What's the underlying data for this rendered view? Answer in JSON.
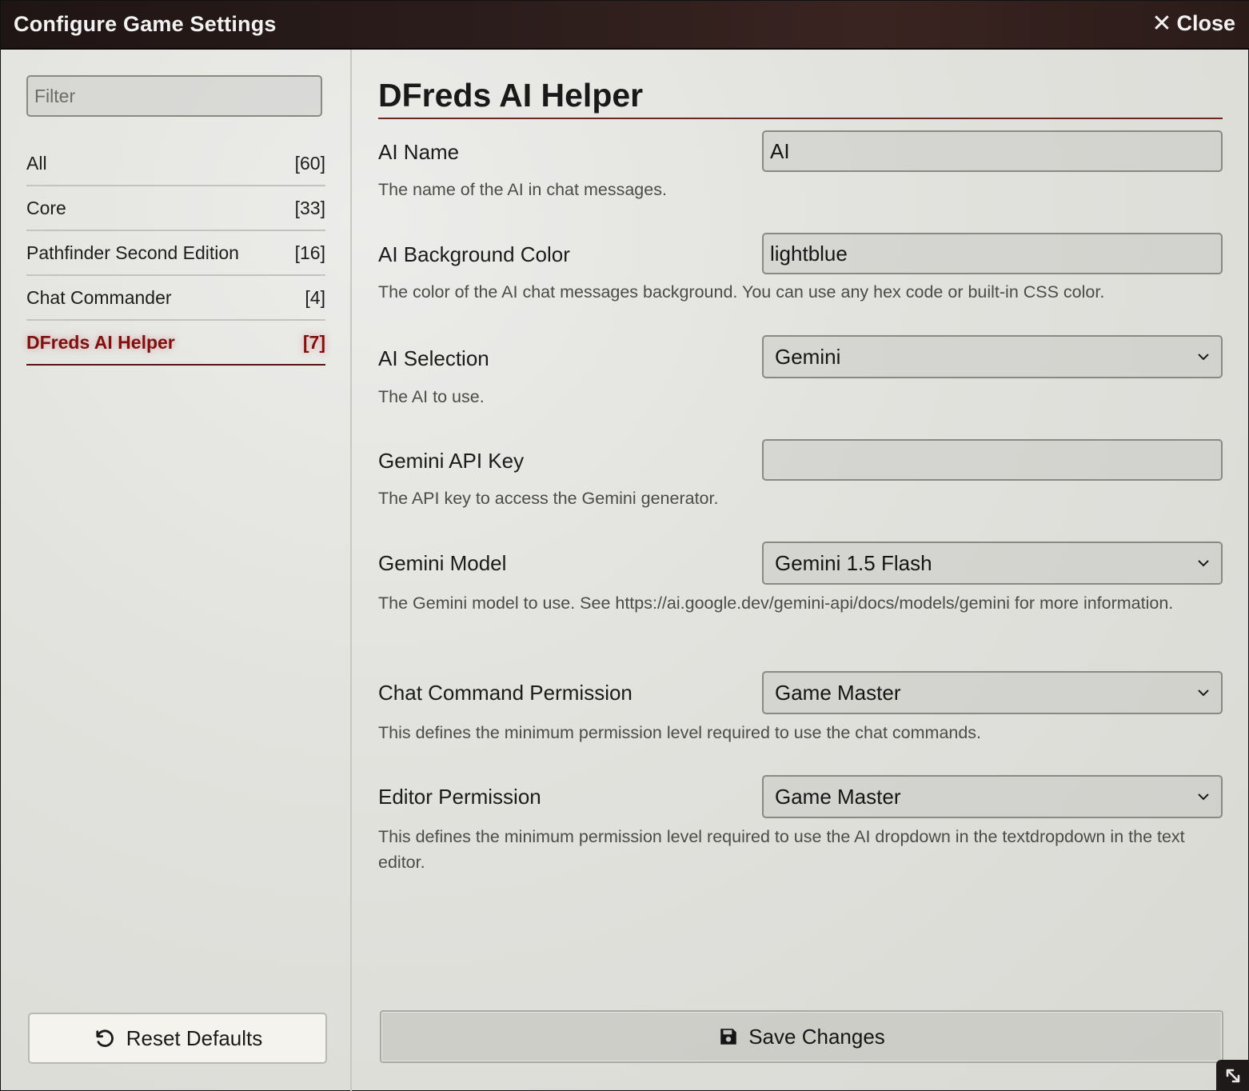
{
  "window": {
    "title": "Configure Game Settings",
    "close_label": "Close"
  },
  "sidebar": {
    "filter_placeholder": "Filter",
    "categories": [
      {
        "label": "All",
        "count": "[60]"
      },
      {
        "label": "Core",
        "count": "[33]"
      },
      {
        "label": "Pathfinder Second Edition",
        "count": "[16]"
      },
      {
        "label": "Chat Commander",
        "count": "[4]"
      },
      {
        "label": "DFreds AI Helper",
        "count": "[7]",
        "active": true
      }
    ],
    "reset_label": "Reset Defaults"
  },
  "main": {
    "heading": "DFreds AI Helper",
    "settings": [
      {
        "label": "AI Name",
        "type": "text",
        "value": "AI",
        "hint": "The name of the AI in chat messages."
      },
      {
        "label": "AI Background Color",
        "type": "text",
        "value": "lightblue",
        "hint": "The color of the AI chat messages background. You can use any hex code or built-in CSS color."
      },
      {
        "label": "AI Selection",
        "type": "select",
        "value": "Gemini",
        "hint": "The AI to use."
      },
      {
        "label": "Gemini API Key",
        "type": "text",
        "value": "",
        "hint": "The API key to access the Gemini generator."
      },
      {
        "label": "Gemini Model",
        "type": "select",
        "value": "Gemini 1.5 Flash",
        "hint": "The Gemini model to use. See https://ai.google.dev/gemini-api/docs/models/gemini for more information."
      },
      {
        "label": "Chat Command Permission",
        "type": "select",
        "value": "Game Master",
        "hint": "This defines the minimum permission level required to use the chat commands."
      },
      {
        "label": "Editor Permission",
        "type": "select",
        "value": "Game Master",
        "hint": "This defines the minimum permission level required to use the AI dropdown in the textdropdown in the text editor."
      }
    ],
    "save_label": "Save Changes"
  },
  "icons": {
    "close": "close-icon",
    "reset": "undo-icon",
    "save": "floppy-disk-icon",
    "select": "chevron-down-icon",
    "resize": "resize-handle-icon"
  }
}
